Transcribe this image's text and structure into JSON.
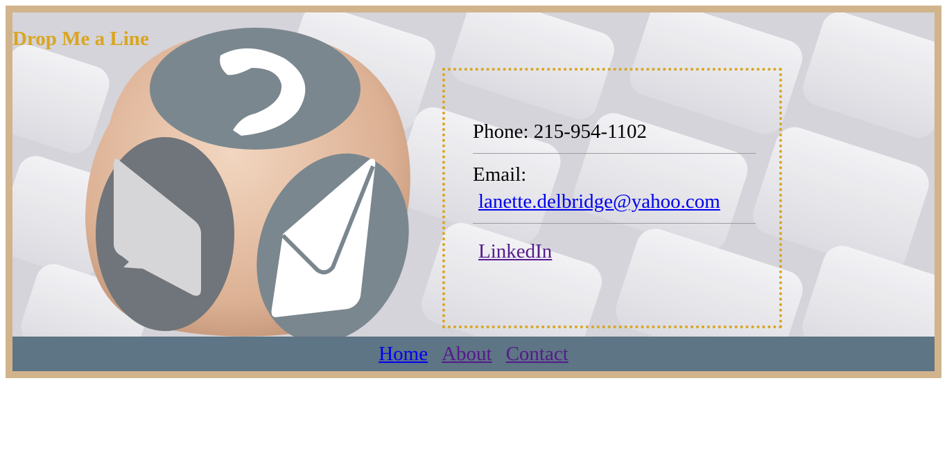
{
  "header": {
    "title": "Drop Me a Line"
  },
  "contact": {
    "phone_text": "Phone: 215-954-1102",
    "email_label": "Email:",
    "email_link": "lanette.delbridge@yahoo.com",
    "linkedin_link": "LinkedIn"
  },
  "nav": {
    "items": [
      "Home",
      "About",
      "Contact"
    ]
  },
  "colors": {
    "frame": "#d2b48c",
    "accent": "#daa520",
    "navbar": "#5d7585",
    "die_circle": "#7a878e"
  },
  "icons": [
    "phone-icon",
    "chat-bubble-icon",
    "envelope-icon"
  ]
}
